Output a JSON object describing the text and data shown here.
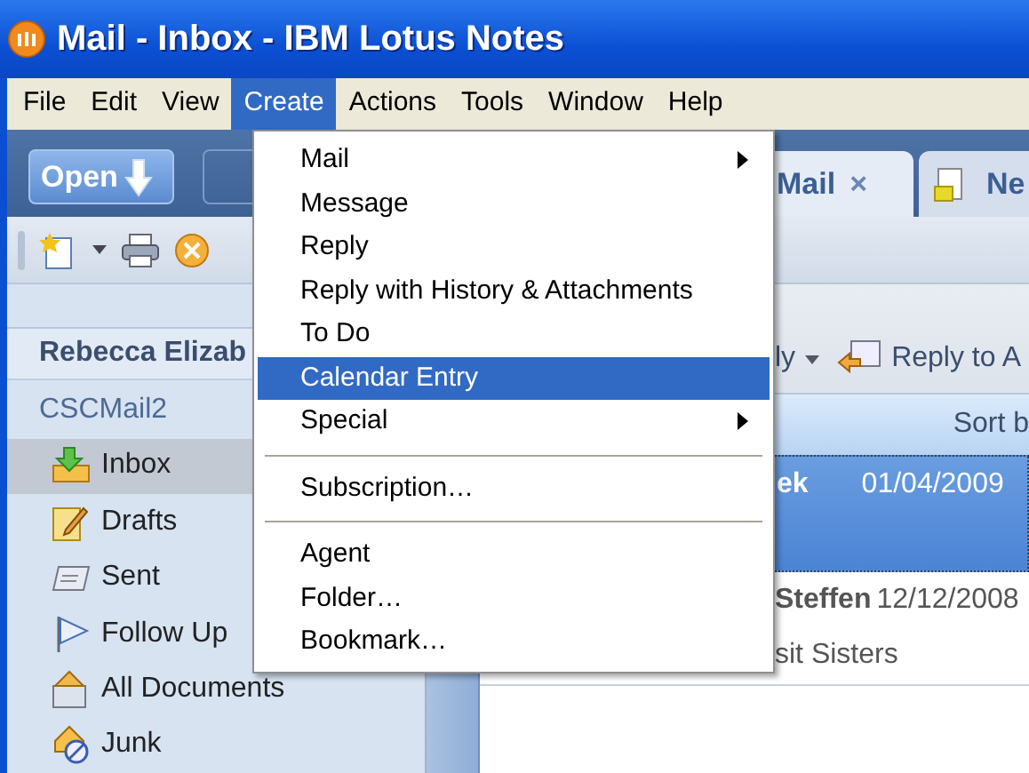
{
  "window": {
    "title": "Mail - Inbox - IBM Lotus Notes"
  },
  "menu_bar": [
    {
      "label": "File",
      "selected": false
    },
    {
      "label": "Edit",
      "selected": false
    },
    {
      "label": "View",
      "selected": false
    },
    {
      "label": "Create",
      "selected": true
    },
    {
      "label": "Actions",
      "selected": false
    },
    {
      "label": "Tools",
      "selected": false
    },
    {
      "label": "Window",
      "selected": false
    },
    {
      "label": "Help",
      "selected": false
    }
  ],
  "toolbar": {
    "open_button": "Open"
  },
  "tabs": [
    {
      "label": "Mail",
      "selected": true,
      "close": "×"
    },
    {
      "label": "Ne",
      "selected": false
    }
  ],
  "sidebar": {
    "account": "Rebecca Elizab",
    "database": "CSCMail2",
    "items": [
      {
        "label": "Inbox",
        "selected": true
      },
      {
        "label": "Drafts",
        "selected": false
      },
      {
        "label": "Sent",
        "selected": false
      },
      {
        "label": "Follow Up",
        "selected": false
      },
      {
        "label": "All Documents",
        "selected": false
      },
      {
        "label": "Junk",
        "selected": false
      }
    ]
  },
  "view_toolbar": [
    {
      "label": "ly",
      "kind": "dropdown"
    },
    {
      "label": "Reply to A",
      "kind": "reply-all"
    }
  ],
  "view_header": {
    "sort": "Sort b"
  },
  "messages": [
    {
      "sender": "ek",
      "date": "01/04/2009",
      "selected": true
    },
    {
      "sender": "Steffen",
      "date": "12/12/2008",
      "subject": "sit Sisters",
      "selected": false
    }
  ],
  "dropdown_menu": [
    {
      "kind": "item",
      "label": "Mail",
      "submenu": true,
      "selected": false
    },
    {
      "kind": "item",
      "label": "Message",
      "submenu": false,
      "selected": false
    },
    {
      "kind": "item",
      "label": "Reply",
      "submenu": false,
      "selected": false
    },
    {
      "kind": "item",
      "label": "Reply with History & Attachments",
      "submenu": false,
      "selected": false
    },
    {
      "kind": "item",
      "label": "To Do",
      "submenu": false,
      "selected": false
    },
    {
      "kind": "item",
      "label": "Calendar Entry",
      "submenu": false,
      "selected": true
    },
    {
      "kind": "item",
      "label": "Special",
      "submenu": true,
      "selected": false
    },
    {
      "kind": "separator"
    },
    {
      "kind": "item",
      "label": "Subscription…",
      "submenu": false,
      "selected": false
    },
    {
      "kind": "separator"
    },
    {
      "kind": "item",
      "label": "Agent",
      "submenu": false,
      "selected": false
    },
    {
      "kind": "item",
      "label": "Folder…",
      "submenu": false,
      "selected": false
    },
    {
      "kind": "item",
      "label": "Bookmark…",
      "submenu": false,
      "selected": false
    }
  ]
}
